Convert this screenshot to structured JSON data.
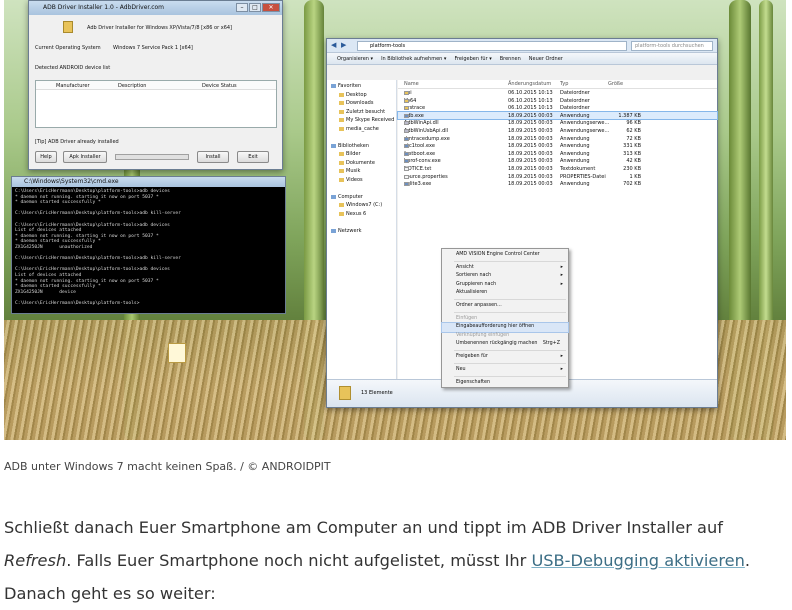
{
  "adb_installer": {
    "title": "ADB Driver Installer 1.0 - AdbDriver.com",
    "heading": "Adb Driver Installer for Windows XP/Vista/7/8 [x86 or x64]",
    "os_label": "Current Operating System",
    "os_value": "Windows 7 Service Pack 1 [x64]",
    "device_list_label": "Detected ANDROID device list",
    "columns": [
      "Manufacturer",
      "Description",
      "Device Status"
    ],
    "status_line": "[Tip] ADB Driver already installed",
    "buttons": {
      "help": "Help",
      "adb_installer": "Apk Installer",
      "install": "Install",
      "exit": "Exit"
    }
  },
  "console": {
    "title": "C:\\Windows\\System32\\cmd.exe",
    "lines": "C:\\Users\\EricHerrmann\\Desktop\\platform-tools>adb devices\n* daemon not running. starting it now on port 5037 *\n* daemon started successfully *\n\nC:\\Users\\EricHerrmann\\Desktop\\platform-tools>adb kill-server\n\nC:\\Users\\EricHerrmann\\Desktop\\platform-tools>adb devices\nList of devices attached\n* daemon not running. starting it now on port 5037 *\n* daemon started successfully *\nZX1G4250JN      unauthorized\n\nC:\\Users\\EricHerrmann\\Desktop\\platform-tools>adb kill-server\n\nC:\\Users\\EricHerrmann\\Desktop\\platform-tools>adb devices\nList of devices attached\n* daemon not running. starting it now on port 5037 *\n* daemon started successfully *\nZX1G4250JN      device\n\nC:\\Users\\EricHerrmann\\Desktop\\platform-tools>"
  },
  "explorer": {
    "path": "platform-tools",
    "search_placeholder": "platform-tools durchsuchen",
    "toolbar": [
      "Organisieren ▾",
      "In Bibliothek aufnehmen ▾",
      "Freigeben für ▾",
      "Brennen",
      "Neuer Ordner"
    ],
    "nav": [
      {
        "label": "Favoriten",
        "group": true
      },
      {
        "label": "Desktop"
      },
      {
        "label": "Downloads"
      },
      {
        "label": "Zuletzt besucht"
      },
      {
        "label": "My Skype Received Files"
      },
      {
        "label": "media_cache"
      },
      {
        "label": ""
      },
      {
        "label": "Bibliotheken",
        "group": true
      },
      {
        "label": "Bilder"
      },
      {
        "label": "Dokumente"
      },
      {
        "label": "Musik"
      },
      {
        "label": "Videos"
      },
      {
        "label": ""
      },
      {
        "label": "Computer",
        "group": true
      },
      {
        "label": "Windows7 (C:)"
      },
      {
        "label": "Nexus 6"
      },
      {
        "label": ""
      },
      {
        "label": "Netzwerk",
        "group": true
      }
    ],
    "columns": [
      "Name",
      "Änderungsdatum",
      "Typ",
      "Größe"
    ],
    "files": [
      {
        "name": "api",
        "date": "06.10.2015 10:13",
        "type": "Dateiordner",
        "size": "",
        "kind": "folder"
      },
      {
        "name": "lib64",
        "date": "06.10.2015 10:13",
        "type": "Dateiordner",
        "size": "",
        "kind": "folder"
      },
      {
        "name": "systrace",
        "date": "06.10.2015 10:13",
        "type": "Dateiordner",
        "size": "",
        "kind": "folder"
      },
      {
        "name": "adb.exe",
        "date": "18.09.2015 00:03",
        "type": "Anwendung",
        "size": "1.387 KB",
        "kind": "exe",
        "selected": true
      },
      {
        "name": "AdbWinApi.dll",
        "date": "18.09.2015 00:03",
        "type": "Anwendungserwe...",
        "size": "96 KB",
        "kind": "dll"
      },
      {
        "name": "AdbWinUsbApi.dll",
        "date": "18.09.2015 00:03",
        "type": "Anwendungserwe...",
        "size": "62 KB",
        "kind": "dll"
      },
      {
        "name": "dmtracedump.exe",
        "date": "18.09.2015 00:03",
        "type": "Anwendung",
        "size": "72 KB",
        "kind": "exe"
      },
      {
        "name": "etc1tool.exe",
        "date": "18.09.2015 00:03",
        "type": "Anwendung",
        "size": "331 KB",
        "kind": "exe"
      },
      {
        "name": "fastboot.exe",
        "date": "18.09.2015 00:03",
        "type": "Anwendung",
        "size": "313 KB",
        "kind": "exe"
      },
      {
        "name": "hprof-conv.exe",
        "date": "18.09.2015 00:03",
        "type": "Anwendung",
        "size": "42 KB",
        "kind": "exe"
      },
      {
        "name": "NOTICE.txt",
        "date": "18.09.2015 00:03",
        "type": "Textdokument",
        "size": "230 KB",
        "kind": "txt"
      },
      {
        "name": "source.properties",
        "date": "18.09.2015 00:03",
        "type": "PROPERTIES-Datei",
        "size": "1 KB",
        "kind": "txt"
      },
      {
        "name": "sqlite3.exe",
        "date": "18.09.2015 00:03",
        "type": "Anwendung",
        "size": "702 KB",
        "kind": "exe"
      }
    ],
    "status": "13 Elemente"
  },
  "context_menu": [
    {
      "label": "AMD VISION Engine Control Center"
    },
    {
      "sep": true
    },
    {
      "label": "Ansicht",
      "arrow": true
    },
    {
      "label": "Sortieren nach",
      "arrow": true
    },
    {
      "label": "Gruppieren nach",
      "arrow": true
    },
    {
      "label": "Aktualisieren"
    },
    {
      "sep": true
    },
    {
      "label": "Ordner anpassen..."
    },
    {
      "sep": true
    },
    {
      "label": "Einfügen",
      "disabled": true
    },
    {
      "label": "Eingabeaufforderung hier öffnen",
      "highlight": true
    },
    {
      "label": "Verknüpfung einfügen",
      "disabled": true
    },
    {
      "label": "Umbenennen rückgängig machen",
      "shortcut": "Strg+Z"
    },
    {
      "sep": true
    },
    {
      "label": "Freigeben für",
      "arrow": true
    },
    {
      "sep": true
    },
    {
      "label": "Neu",
      "arrow": true
    },
    {
      "sep": true
    },
    {
      "label": "Eigenschaften"
    }
  ],
  "caption": "ADB unter Windows 7 macht keinen Spaß. / © ANDROIDPIT",
  "paragraph": {
    "part1": "Schließt danach Euer Smartphone am Computer an und tippt im ADB Driver Installer auf ",
    "em": "Refresh",
    "part2": ". Falls Euer Smartphone noch nicht aufgelistet, müsst Ihr ",
    "link": "USB-Debugging aktivieren",
    "part3": ".",
    "line2": "Danach geht es so weiter:"
  },
  "colors": {
    "link": "#3c6e85",
    "selection": "#dcebfc",
    "console_bg": "#000000"
  }
}
